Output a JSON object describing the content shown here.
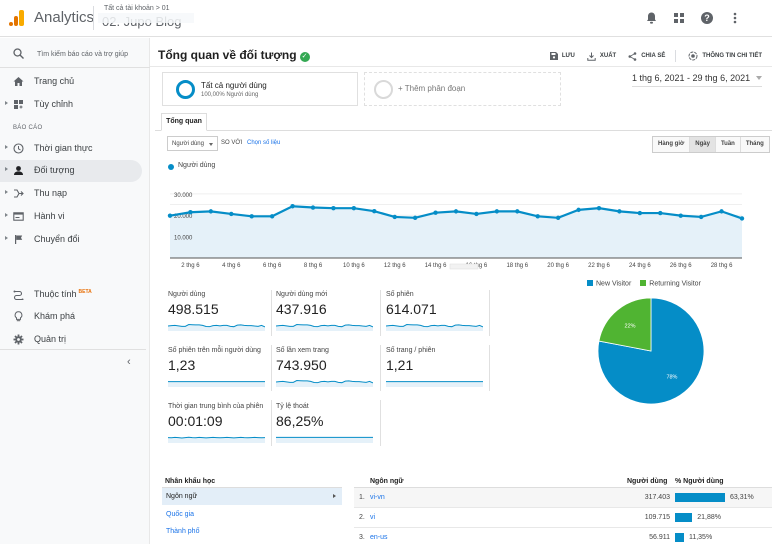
{
  "topbar": {
    "app_name": "Analytics",
    "breadcrumb": "Tất cả tài khoản > 01",
    "property": "02. Jupo Blog",
    "icons": [
      "bell-icon",
      "apps-grid-icon",
      "help-icon",
      "more-vert-icon"
    ]
  },
  "sidebar": {
    "search_placeholder": "Tìm kiếm báo cáo và trợ giúp",
    "top_items": [
      {
        "label": "Trang chủ",
        "icon": "home-icon",
        "expandable": false
      },
      {
        "label": "Tùy chỉnh",
        "icon": "dashboard-icon",
        "expandable": true
      }
    ],
    "section_label": "BÁO CÁO",
    "report_items": [
      {
        "label": "Thời gian thực",
        "icon": "clock-icon",
        "expandable": true,
        "active": false
      },
      {
        "label": "Đối tượng",
        "icon": "person-icon",
        "expandable": true,
        "active": true
      },
      {
        "label": "Thu nạp",
        "icon": "acquisition-icon",
        "expandable": true,
        "active": false
      },
      {
        "label": "Hành vi",
        "icon": "behavior-icon",
        "expandable": true,
        "active": false
      },
      {
        "label": "Chuyển đổi",
        "icon": "flag-icon",
        "expandable": true,
        "active": false
      }
    ],
    "bottom_items": [
      {
        "label": "Thuộc tính",
        "badge": "BETA",
        "icon": "attribution-icon"
      },
      {
        "label": "Khám phá",
        "icon": "lightbulb-icon"
      },
      {
        "label": "Quản trị",
        "icon": "gear-icon"
      }
    ]
  },
  "header": {
    "title": "Tổng quan về đối tượng",
    "actions": [
      {
        "label": "LƯU",
        "icon": "save-icon"
      },
      {
        "label": "XUẤT",
        "icon": "export-icon"
      },
      {
        "label": "CHIA SẺ",
        "icon": "share-icon"
      },
      {
        "label": "THÔNG TIN CHI TIẾT",
        "icon": "insights-icon"
      }
    ]
  },
  "segments": {
    "active": {
      "name": "Tất cả người dùng",
      "sub": "100,00% Người dùng"
    },
    "add_label": "+ Thêm phân đoạn"
  },
  "date_range": "1 thg 6, 2021 - 29 thg 6, 2021",
  "tabs": [
    "Tổng quan"
  ],
  "controls": {
    "metric_select": "Người dùng",
    "vs_label": "so với",
    "pick_metric": "Chọn số liệu",
    "granularity": [
      {
        "label": "Hàng giờ",
        "active": false
      },
      {
        "label": "Ngày",
        "active": true
      },
      {
        "label": "Tuần",
        "active": false
      },
      {
        "label": "Tháng",
        "active": false
      }
    ]
  },
  "chart_data": {
    "type": "area",
    "title": "",
    "legend": [
      "Người dùng"
    ],
    "legend_position": "top-left",
    "color": "#058dc7",
    "fill": "#e5f1f9",
    "x": [
      1,
      2,
      3,
      4,
      5,
      6,
      7,
      8,
      9,
      10,
      11,
      12,
      13,
      14,
      15,
      16,
      17,
      18,
      19,
      20,
      21,
      22,
      23,
      24,
      25,
      26,
      27,
      28,
      29
    ],
    "x_tick_labels": [
      "2 thg 6",
      "4 thg 6",
      "6 thg 6",
      "8 thg 6",
      "10 thg 6",
      "12 thg 6",
      "14 thg 6",
      "16 thg 6",
      "18 thg 6",
      "20 thg 6",
      "22 thg 6",
      "24 thg 6",
      "26 thg 6",
      "28 thg 6"
    ],
    "x_ticks": [
      2,
      4,
      6,
      8,
      10,
      12,
      14,
      16,
      18,
      20,
      22,
      24,
      26,
      28
    ],
    "series": [
      {
        "name": "Người dùng",
        "values": [
          19800,
          21400,
          21800,
          20600,
          19500,
          19500,
          24200,
          23600,
          23300,
          23300,
          21900,
          19200,
          18800,
          21200,
          21800,
          20600,
          21800,
          21800,
          19500,
          18800,
          22500,
          23300,
          21800,
          21000,
          21000,
          19800,
          19200,
          21800,
          18500
        ]
      }
    ],
    "y_ticks": [
      10000,
      20000,
      30000
    ],
    "y_tick_labels": [
      "10.000",
      "20.000",
      "30.000"
    ],
    "ylim": [
      0,
      30000
    ],
    "grid": true
  },
  "metrics": [
    {
      "name": "Người dùng",
      "value": "498.515",
      "spark": [
        0.55,
        0.6,
        0.62,
        0.57,
        0.52,
        0.52,
        0.72,
        0.7,
        0.68,
        0.68,
        0.62,
        0.5,
        0.48,
        0.6,
        0.62,
        0.57,
        0.62,
        0.62,
        0.52,
        0.48,
        0.65,
        0.68,
        0.62,
        0.6,
        0.6,
        0.55,
        0.52,
        0.62,
        0.46
      ]
    },
    {
      "name": "Người dùng mới",
      "value": "437.916",
      "spark": [
        0.55,
        0.6,
        0.62,
        0.57,
        0.52,
        0.52,
        0.72,
        0.7,
        0.68,
        0.68,
        0.62,
        0.5,
        0.48,
        0.6,
        0.62,
        0.57,
        0.62,
        0.62,
        0.52,
        0.48,
        0.65,
        0.68,
        0.62,
        0.6,
        0.6,
        0.55,
        0.52,
        0.62,
        0.46
      ]
    },
    {
      "name": "Số phiên",
      "value": "614.071",
      "spark": [
        0.55,
        0.6,
        0.62,
        0.57,
        0.52,
        0.52,
        0.72,
        0.7,
        0.68,
        0.68,
        0.62,
        0.5,
        0.48,
        0.6,
        0.62,
        0.57,
        0.62,
        0.62,
        0.52,
        0.48,
        0.65,
        0.68,
        0.62,
        0.6,
        0.6,
        0.55,
        0.52,
        0.62,
        0.46
      ]
    },
    {
      "name": "Số phiên trên mỗi người dùng",
      "value": "1,23",
      "spark": [
        0.6,
        0.6,
        0.6,
        0.6,
        0.6,
        0.6,
        0.6,
        0.6,
        0.6,
        0.6,
        0.6,
        0.6,
        0.6,
        0.6,
        0.6,
        0.6,
        0.6,
        0.6,
        0.6,
        0.6,
        0.6,
        0.6,
        0.6,
        0.6,
        0.6,
        0.6,
        0.6,
        0.6,
        0.6
      ]
    },
    {
      "name": "Số lần xem trang",
      "value": "743.950",
      "spark": [
        0.55,
        0.6,
        0.62,
        0.57,
        0.52,
        0.52,
        0.72,
        0.7,
        0.68,
        0.68,
        0.62,
        0.5,
        0.48,
        0.6,
        0.62,
        0.57,
        0.62,
        0.62,
        0.52,
        0.48,
        0.65,
        0.68,
        0.62,
        0.6,
        0.6,
        0.55,
        0.52,
        0.62,
        0.46
      ]
    },
    {
      "name": "Số trang / phiên",
      "value": "1,21",
      "spark": [
        0.6,
        0.6,
        0.6,
        0.6,
        0.6,
        0.6,
        0.6,
        0.6,
        0.6,
        0.6,
        0.6,
        0.6,
        0.6,
        0.6,
        0.6,
        0.6,
        0.6,
        0.6,
        0.6,
        0.6,
        0.6,
        0.6,
        0.6,
        0.6,
        0.6,
        0.6,
        0.6,
        0.6,
        0.6
      ]
    },
    {
      "name": "Thời gian trung bình của phiên",
      "value": "00:01:09",
      "spark": [
        0.6,
        0.58,
        0.62,
        0.6,
        0.56,
        0.6,
        0.64,
        0.6,
        0.58,
        0.62,
        0.6,
        0.57,
        0.6,
        0.62,
        0.6,
        0.58,
        0.6,
        0.62,
        0.6,
        0.57,
        0.6,
        0.63,
        0.6,
        0.58,
        0.6,
        0.62,
        0.6,
        0.58,
        0.6
      ]
    },
    {
      "name": "Tỷ lệ thoát",
      "value": "86,25%",
      "spark": [
        0.62,
        0.62,
        0.62,
        0.62,
        0.62,
        0.62,
        0.62,
        0.62,
        0.62,
        0.62,
        0.62,
        0.62,
        0.62,
        0.62,
        0.62,
        0.62,
        0.62,
        0.62,
        0.62,
        0.62,
        0.62,
        0.62,
        0.62,
        0.62,
        0.62,
        0.62,
        0.62,
        0.62,
        0.62
      ]
    }
  ],
  "pie": {
    "type": "pie",
    "legend": [
      {
        "name": "New Visitor",
        "color": "#058dc7"
      },
      {
        "name": "Returning Visitor",
        "color": "#50b432"
      }
    ],
    "slices": [
      {
        "name": "New Visitor",
        "value": 78,
        "label": "78%",
        "color": "#058dc7"
      },
      {
        "name": "Returning Visitor",
        "value": 22,
        "label": "22%",
        "color": "#50b432"
      }
    ]
  },
  "demographics": {
    "heading": "Nhân khẩu học",
    "items": [
      {
        "label": "Ngôn ngữ",
        "selected": true
      },
      {
        "label": "Quốc gia",
        "selected": false
      },
      {
        "label": "Thành phố",
        "selected": false
      }
    ]
  },
  "language_table": {
    "headers": {
      "dimension": "Ngôn ngữ",
      "users": "Người dùng",
      "pct": "% Người dùng"
    },
    "rows": [
      {
        "index": "1.",
        "language": "vi-vn",
        "users": "317.403",
        "pct_label": "63,31%",
        "pct": 63.31
      },
      {
        "index": "2.",
        "language": "vi",
        "users": "109.715",
        "pct_label": "21,88%",
        "pct": 21.88
      },
      {
        "index": "3.",
        "language": "en-us",
        "users": "56.911",
        "pct_label": "11,35%",
        "pct": 11.35
      }
    ]
  }
}
